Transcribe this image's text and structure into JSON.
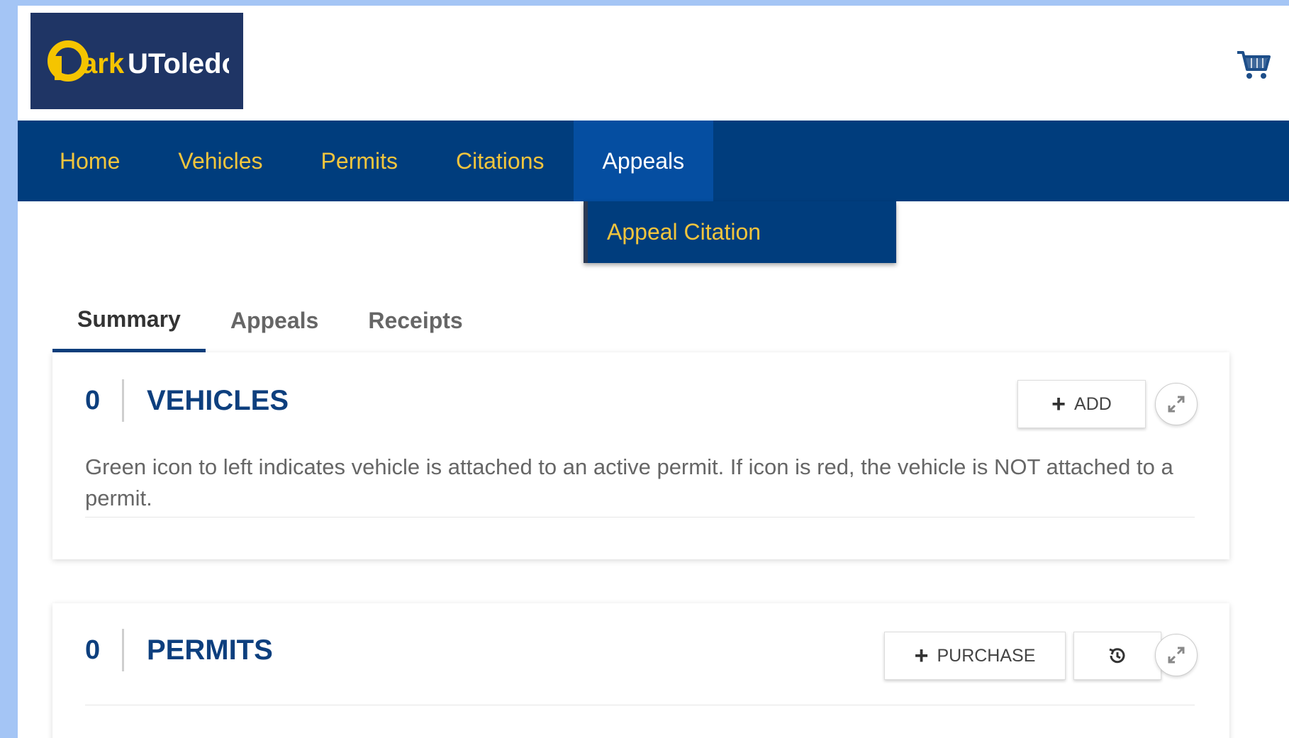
{
  "header": {
    "logo_text": "ParkUToledo",
    "cart_icon": "shopping-cart-icon"
  },
  "nav": {
    "items": [
      {
        "label": "Home"
      },
      {
        "label": "Vehicles"
      },
      {
        "label": "Permits"
      },
      {
        "label": "Citations"
      },
      {
        "label": "Appeals"
      }
    ],
    "active": "Appeals",
    "dropdown": {
      "items": [
        {
          "label": "Appeal Citation"
        }
      ]
    }
  },
  "tabs": {
    "items": [
      {
        "label": "Summary"
      },
      {
        "label": "Appeals"
      },
      {
        "label": "Receipts"
      }
    ],
    "active": "Summary"
  },
  "vehicles": {
    "count": "0",
    "title": "VEHICLES",
    "add_label": "ADD",
    "description": "Green icon to left indicates vehicle is attached to an active permit. If icon is red, the vehicle is NOT attached to a permit."
  },
  "permits": {
    "count": "0",
    "title": "PERMITS",
    "purchase_label": "PURCHASE"
  },
  "colors": {
    "nav_bg": "#003d7d",
    "nav_text": "#f2c53d",
    "nav_active_bg": "#054ea1",
    "logo_bg": "#1f3565",
    "heading": "#0d3f7e",
    "outer_bg": "#a4c5f5"
  }
}
